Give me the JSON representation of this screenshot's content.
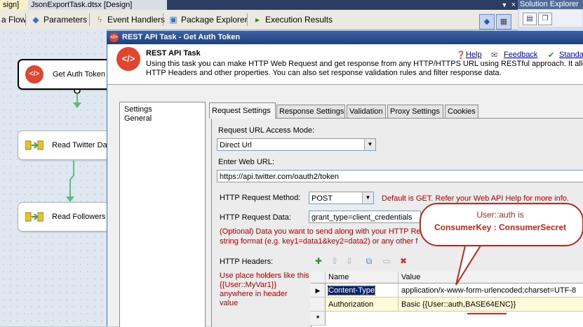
{
  "doc_tabs": {
    "design_tab": "sign]",
    "json_tab": "JsonExportTask.dtsx [Design]"
  },
  "solution_explorer": {
    "title": "Solution Explorer"
  },
  "designer_tabs": [
    {
      "label": "a Flow",
      "icon": "data-flow-icon"
    },
    {
      "label": "Parameters",
      "icon": "parameters-icon"
    },
    {
      "label": "Event Handlers",
      "icon": "event-handlers-icon"
    },
    {
      "label": "Package Explorer",
      "icon": "package-explorer-icon"
    },
    {
      "label": "Execution Results",
      "icon": "execution-results-icon"
    }
  ],
  "canvas": {
    "tasks": [
      {
        "label": "Get Auth Token",
        "icon": "rest-api-icon"
      },
      {
        "label": "Read Twitter Da",
        "icon": "data-flow-task-icon"
      },
      {
        "label": "Read Followers",
        "icon": "data-flow-task-icon"
      }
    ],
    "connector_color": "#5fba7d"
  },
  "dialog": {
    "title": "REST API Task - Get Auth Token",
    "header": {
      "title": "REST API Task",
      "description_1": "Using this task you can make HTTP Web Request and get response from any HTTP/HTTPS URL using RESTful approach. It allows y",
      "description_2": "HTTP Headers and other properties. You can also set response validation rules and filter response data.",
      "help": "Help",
      "feedback": "Feedback",
      "standard": "Standa"
    },
    "nav": [
      "Settings",
      "General"
    ],
    "tabs": [
      "Request Settings",
      "Response Settings",
      "Validation",
      "Proxy Settings",
      "Cookies"
    ],
    "request": {
      "access_mode_label": "Request URL Access Mode:",
      "access_mode_value": "Direct Url",
      "url_label": "Enter Web URL:",
      "url_value": "https://api.twitter.com/oauth2/token",
      "method_label": "HTTP Request Method:",
      "method_value": "POST",
      "method_hint": "Default is GET. Refer your Web API Help for more info.",
      "data_label": "HTTP Request Data:",
      "data_value": "grant_type=client_credentials",
      "data_hint_1": "(Optional) Data you want to send along with your HTTP Re",
      "data_hint_2": "string format (e.g. key1=data1&key2=data2) or any other f",
      "headers_label": "HTTP Headers:",
      "headers_hint_1": "Use place holders like this",
      "headers_hint_2": "{{User::MyVar1}}",
      "headers_hint_3": "anywhere in header",
      "headers_hint_4": "value",
      "grid": {
        "columns": [
          "Name",
          "Value"
        ],
        "rows": [
          {
            "name": "Content-Type",
            "value": "application/x-www-form-urlencoded;charset=UTF-8"
          },
          {
            "name": "Authorization",
            "value": "Basic {{User::auth,BASE64ENC}}"
          }
        ],
        "new_row_marker": "*"
      }
    },
    "callout": {
      "line1": "User::auth is",
      "line2": "ConsumerKey : ConsumerSecret",
      "color": "#c0281e"
    }
  }
}
